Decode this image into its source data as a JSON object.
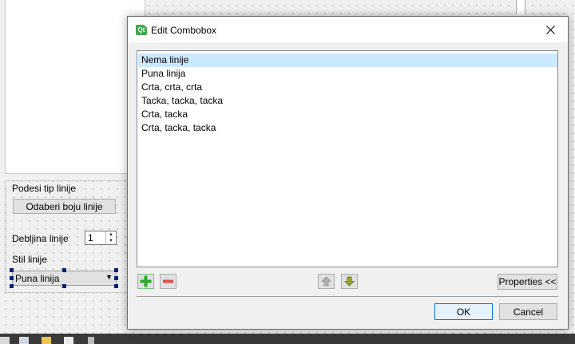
{
  "form": {
    "group_title": "Podesi tip linije",
    "color_button": "Odaberi boju linije",
    "thickness_label": "Debljina linije",
    "thickness_value": "1",
    "style_label": "Stil linije",
    "style_value": "Puna linija"
  },
  "dialog": {
    "title": "Edit Combobox",
    "app_icon_text": "Qt",
    "items": [
      {
        "label": "Nema linije",
        "selected": true
      },
      {
        "label": "Puna linija",
        "selected": false
      },
      {
        "label": "Crta, crta, crta",
        "selected": false
      },
      {
        "label": "Tacka, tacka, tacka",
        "selected": false
      },
      {
        "label": "Crta, tacka",
        "selected": false
      },
      {
        "label": "Crta, tacka, tacka",
        "selected": false
      }
    ],
    "properties_button": "Properties <<",
    "ok_button": "OK",
    "cancel_button": "Cancel"
  },
  "colors": {
    "selection": "#cce8ff",
    "add_icon": "#2ea82e",
    "remove_icon": "#e05050",
    "accent_border": "#0078d7"
  },
  "icons": {
    "add": "plus-icon",
    "remove": "minus-icon",
    "move_up": "arrow-up-icon",
    "move_down": "arrow-down-icon",
    "close": "close-icon"
  }
}
